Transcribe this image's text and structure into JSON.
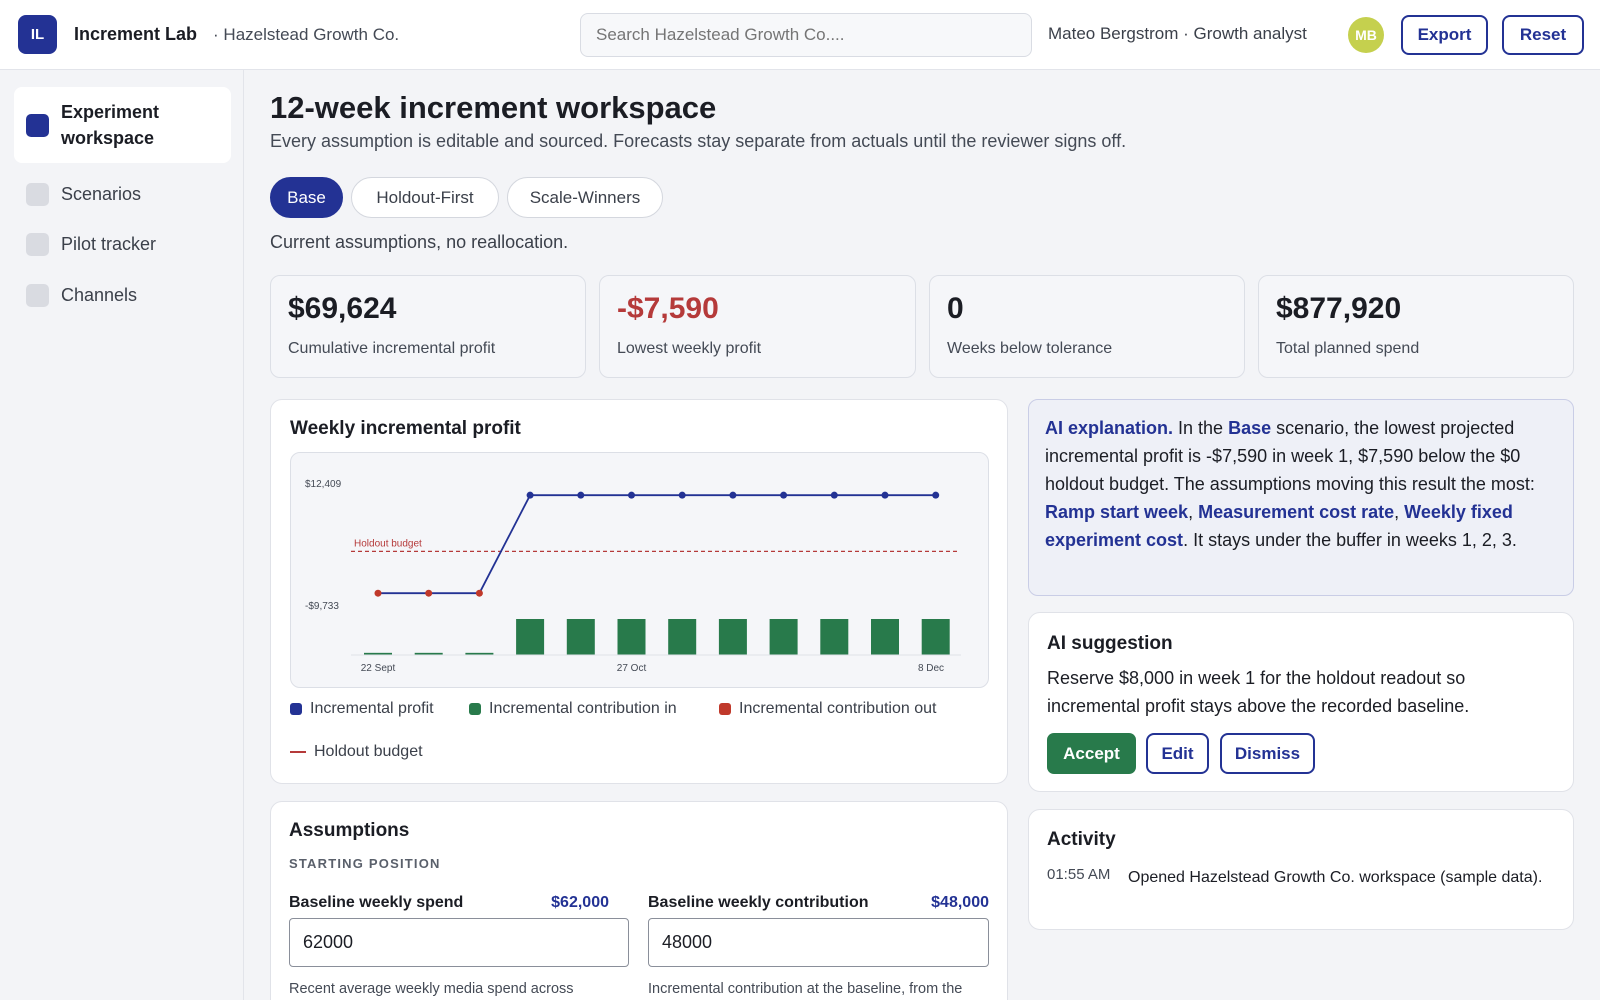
{
  "header": {
    "logo_initials": "IL",
    "brand": "Increment Lab",
    "org": "· Hazelstead Growth Co.",
    "search_placeholder": "Search Hazelstead Growth Co....",
    "user": "Mateo Bergstrom · Growth analyst",
    "avatar_initials": "MB",
    "export_label": "Export",
    "reset_label": "Reset"
  },
  "sidebar": {
    "items": [
      {
        "label": "Experiment workspace",
        "active": true
      },
      {
        "label": "Scenarios",
        "active": false
      },
      {
        "label": "Pilot tracker",
        "active": false
      },
      {
        "label": "Channels",
        "active": false
      }
    ]
  },
  "page": {
    "title": "12-week increment workspace",
    "subtitle": "Every assumption is editable and sourced. Forecasts stay separate from actuals until the reviewer signs off.",
    "scenarios": [
      "Base",
      "Holdout-First",
      "Scale-Winners"
    ],
    "active_scenario": "Base",
    "scenario_desc": "Current assumptions, no reallocation."
  },
  "kpis": [
    {
      "value": "$69,624",
      "label": "Cumulative incremental profit",
      "negative": false
    },
    {
      "value": "-$7,590",
      "label": "Lowest weekly profit",
      "negative": true
    },
    {
      "value": "0",
      "label": "Weeks below tolerance",
      "negative": false
    },
    {
      "value": "$877,920",
      "label": "Total planned spend",
      "negative": false
    }
  ],
  "chart_card": {
    "title": "Weekly incremental profit",
    "legend": {
      "profit": "Incremental profit",
      "contrib_in": "Incremental contribution in",
      "contrib_out": "Incremental contribution out",
      "holdout": "Holdout budget"
    }
  },
  "chart_data": {
    "type": "line",
    "y_tick_labels": [
      "$12,409",
      "-$9,733"
    ],
    "y_ticks": [
      12409,
      -9733
    ],
    "x_tick_labels": [
      "22 Sept",
      "27 Oct",
      "8 Dec"
    ],
    "x_tick_index": [
      0,
      5,
      11
    ],
    "holdout_label": "Holdout budget",
    "holdout_value": 0,
    "series": [
      {
        "name": "Incremental profit",
        "kind": "line",
        "values": [
          -7590,
          -7590,
          -7590,
          10200,
          10200,
          10200,
          10200,
          10200,
          10200,
          10200,
          10200,
          10200
        ]
      },
      {
        "name": "Incremental contribution in",
        "kind": "bar",
        "values": [
          150,
          150,
          150,
          2500,
          2500,
          2500,
          2500,
          2500,
          2500,
          2500,
          2500,
          2500
        ]
      }
    ],
    "bar_max": 2500,
    "colors": {
      "line": "#233294",
      "negative_point": "#c0392b",
      "bar": "#287a4b",
      "holdout": "#b53a3a"
    }
  },
  "ai_explanation": {
    "lead": "AI explanation.",
    "t1": " In the ",
    "scenario": "Base",
    "t2": " scenario, the lowest projected incremental profit is -$7,590 in week 1, $7,590 below the $0 holdout budget. The assumptions moving this result the most: ",
    "a1": "Ramp start week",
    "sep1": ", ",
    "a2": "Measurement cost rate",
    "sep2": ", ",
    "a3": "Weekly fixed experiment cost",
    "t3": ". It stays under the buffer in weeks 1, 2, 3."
  },
  "suggestion": {
    "title": "AI suggestion",
    "text": "Reserve $8,000 in week 1 for the holdout readout so incremental profit stays above the recorded baseline.",
    "accept": "Accept",
    "edit": "Edit",
    "dismiss": "Dismiss"
  },
  "activity": {
    "title": "Activity",
    "items": [
      {
        "time": "01:55 AM",
        "text": "Opened Hazelstead Growth Co. workspace (sample data)."
      }
    ]
  },
  "assumptions": {
    "title": "Assumptions",
    "section": "STARTING POSITION",
    "fields": [
      {
        "label": "Baseline weekly spend",
        "display": "$62,000",
        "value": "62000",
        "help": "Recent average weekly media spend across channels."
      },
      {
        "label": "Baseline weekly contribution",
        "display": "$48,000",
        "value": "48000",
        "help": "Incremental contribution at the baseline, from the last validated holdout."
      }
    ]
  }
}
